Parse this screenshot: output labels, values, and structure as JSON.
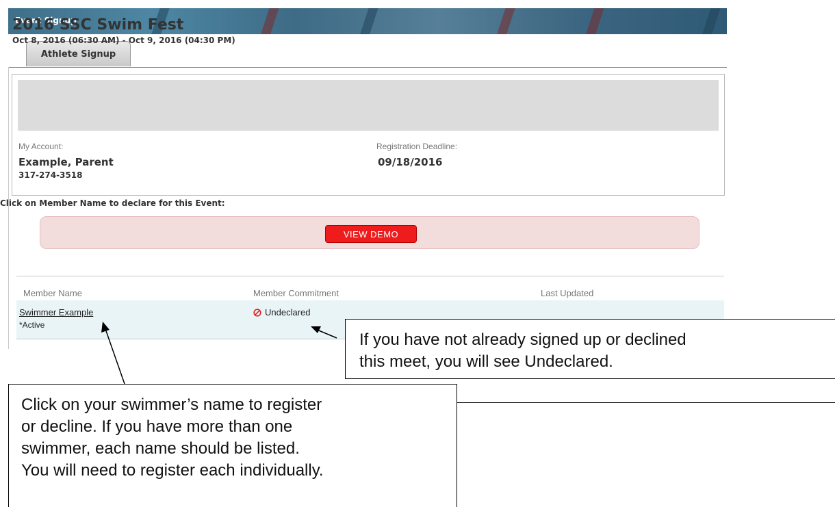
{
  "header": {
    "title": "Event Signup"
  },
  "tabs": [
    {
      "label": "Athlete Signup"
    }
  ],
  "event": {
    "name": "2016 SSC Swim Fest",
    "dates": "Oct 8, 2016 (06:30 AM) - Oct 9, 2016 (04:30 PM)"
  },
  "account": {
    "label": "My Account:",
    "name": "Example, Parent",
    "phone": "317-274-3518"
  },
  "deadline": {
    "label": "Registration Deadline:",
    "value": "09/18/2016"
  },
  "instruction": "Click on Member Name to declare for this Event:",
  "demo": {
    "button_label": "VIEW DEMO"
  },
  "table": {
    "columns": [
      "Member Name",
      "Member Commitment",
      "Last Updated"
    ],
    "rows": [
      {
        "name": "Swimmer Example",
        "status": "*Active",
        "commitment": "Undeclared",
        "last_updated": ""
      }
    ]
  },
  "callouts": {
    "right_lines": [
      "If you have not already signed up or declined",
      "this meet, you will see Undeclared."
    ],
    "left_lines": [
      "Click on your swimmer’s name to register",
      "or decline.  If you have more than one",
      "swimmer, each name should be listed.",
      "You will need to register each individually."
    ]
  },
  "icons": {
    "commitment": "ban-icon"
  },
  "colors": {
    "demo_button": "#ee1c1c",
    "row_highlight": "#e9f4f7",
    "header_bg": "#dcdcdc"
  }
}
